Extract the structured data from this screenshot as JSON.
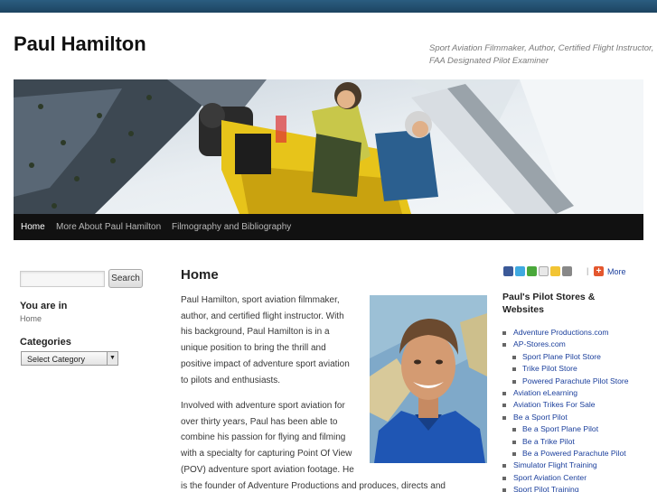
{
  "site": {
    "title": "Paul Hamilton",
    "tagline_line1": "Sport Aviation Filmmaker, Author, Certified Flight Instructor,",
    "tagline_line2": "FAA Designated Pilot Examiner"
  },
  "nav": {
    "items": [
      {
        "label": "Home"
      },
      {
        "label": "More About Paul Hamilton"
      },
      {
        "label": "Filmography and Bibliography"
      }
    ]
  },
  "sidebar_left": {
    "search_button": "Search",
    "search_placeholder": "",
    "you_are_in_title": "You are in",
    "you_are_in_value": "Home",
    "categories_title": "Categories",
    "categories_selected": "Select Category"
  },
  "main": {
    "title": "Home",
    "para1": [
      "Paul Hamilton, sport aviation filmmaker,",
      "author, and certified flight instructor. With",
      "his background, Paul Hamilton is in a",
      "unique position to bring the thrill and",
      "positive impact of adventure sport aviation",
      "to pilots and enthusiasts."
    ],
    "para2": [
      "Involved with adventure sport aviation for",
      "over thirty years, Paul has been able to",
      "combine his passion for flying and filming",
      "with a specialty for capturing Point Of View",
      "(POV) adventure sport aviation footage. He",
      "is the founder of Adventure Productions and produces, directs and"
    ]
  },
  "sidebar_right": {
    "share_more": "More",
    "share_icons": [
      "facebook-icon",
      "twitter-icon",
      "stumbleupon-icon",
      "email-icon",
      "favorites-icon",
      "print-icon"
    ],
    "stores_title": "Paul's Pilot Stores & Websites",
    "links": [
      {
        "label": "Adventure Productions.com",
        "level": 1
      },
      {
        "label": "AP-Stores.com",
        "level": 1
      },
      {
        "label": "Sport Plane Pilot Store",
        "level": 2
      },
      {
        "label": "Trike Pilot Store",
        "level": 2
      },
      {
        "label": "Powered Parachute Pilot Store",
        "level": 2
      },
      {
        "label": "Aviation eLearning",
        "level": 1
      },
      {
        "label": "Aviation Trikes For Sale",
        "level": 1
      },
      {
        "label": "Be a Sport Pilot",
        "level": 1
      },
      {
        "label": "Be a Sport Plane Pilot",
        "level": 2
      },
      {
        "label": "Be a Trike Pilot",
        "level": 2
      },
      {
        "label": "Be a Powered Parachute Pilot",
        "level": 2
      },
      {
        "label": "Simulator Flight Training",
        "level": 1
      },
      {
        "label": "Sport Aviation Center",
        "level": 1
      },
      {
        "label": "Sport Pilot Training",
        "level": 1
      }
    ]
  },
  "colors": {
    "topbar": "#1d4461",
    "nav_bg": "#111111",
    "link": "#1b3f9c"
  }
}
